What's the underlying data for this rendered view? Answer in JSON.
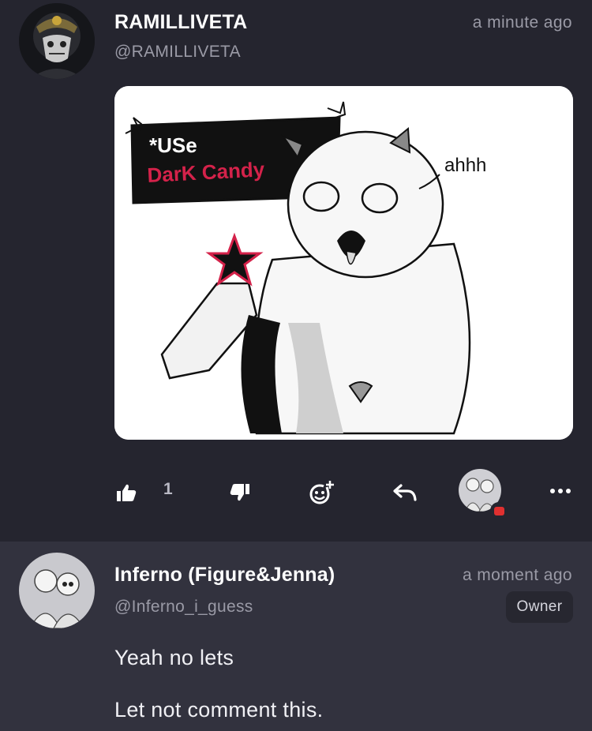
{
  "post": {
    "author_name": "RAMILLIVETA",
    "author_handle": "@RAMILLIVETA",
    "timestamp": "a minute ago",
    "image": {
      "caption_line1": "*USe",
      "caption_line2": "DarK Candy",
      "speech": "ahhh"
    },
    "actions": {
      "like_icon": "thumbs-up-icon",
      "like_count": "1",
      "dislike_icon": "thumbs-down-icon",
      "react_icon": "add-reaction-icon",
      "reply_icon": "reply-arrow-icon",
      "more_icon": "more-dots-icon"
    }
  },
  "reply": {
    "author_name": "Inferno (Figure&Jenna)",
    "author_handle": "@Inferno_i_guess",
    "timestamp": "a moment ago",
    "badge": "Owner",
    "lines": [
      "Yeah no lets",
      "Let not comment this."
    ]
  },
  "colors": {
    "background": "#25252f",
    "reply_background": "#32323e",
    "muted_text": "#9a9aa6",
    "badge_red": "#e03030",
    "candy_red": "#d4224a"
  }
}
